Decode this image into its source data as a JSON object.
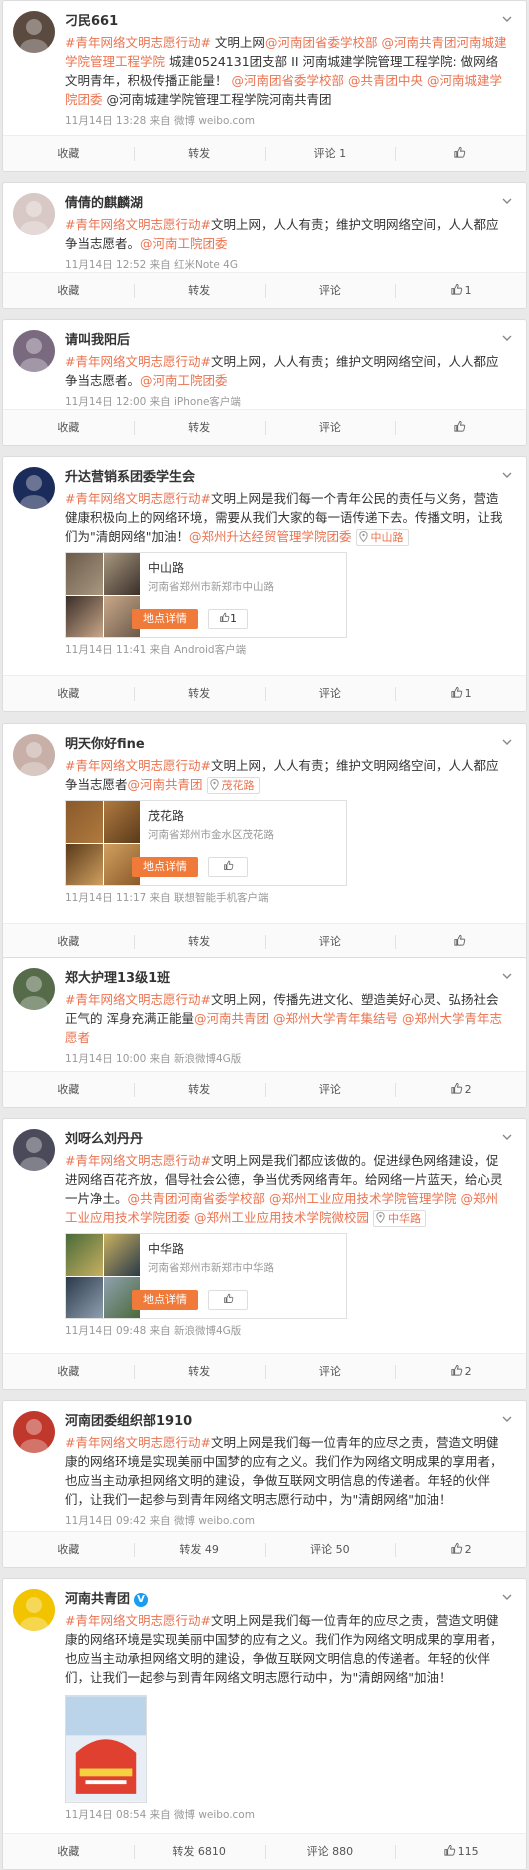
{
  "actions": {
    "collect": "收藏",
    "repost": "转发",
    "comment": "评论"
  },
  "location_button": "地点详情",
  "posts": [
    {
      "user": "刁民661",
      "text": [
        {
          "t": "#青年网络文明志愿行动#",
          "h": true
        },
        {
          "t": " 文明上网",
          "h": false
        },
        {
          "t": "@河南团省委学校部",
          "h": true
        },
        {
          "t": " ",
          "h": false
        },
        {
          "t": "@河南共青团河南城建学院管理工程学院",
          "h": true
        },
        {
          "t": " 城建0524131团支部 II 河南城建学院管理工程学院: 做网络文明青年，积极传播正能量！ ",
          "h": false
        },
        {
          "t": "@河南团省委学校部",
          "h": true
        },
        {
          "t": " ",
          "h": false
        },
        {
          "t": "@共青团中央",
          "h": true
        },
        {
          "t": " ",
          "h": false
        },
        {
          "t": "@河南城建学院团委",
          "h": true
        },
        {
          "t": " @河南城建学院管理工程学院河南共青团",
          "h": false
        }
      ],
      "meta": "11月14日 13:28 来自 微博 weibo.com",
      "repost": "",
      "comment": "1",
      "like": ""
    },
    {
      "user": "倩倩的麒麟湖",
      "text": [
        {
          "t": "#青年网络文明志愿行动#",
          "h": true
        },
        {
          "t": "文明上网，人人有责；维护文明网络空间，人人都应争当志愿者。",
          "h": false
        },
        {
          "t": "@河南工院团委",
          "h": true
        }
      ],
      "meta": "11月14日 12:52 来自 红米Note 4G",
      "repost": "",
      "comment": "",
      "like": "1"
    },
    {
      "user": "请叫我阳后",
      "text": [
        {
          "t": "#青年网络文明志愿行动#",
          "h": true
        },
        {
          "t": "文明上网，人人有责；维护文明网络空间，人人都应争当志愿者。",
          "h": false
        },
        {
          "t": "@河南工院团委",
          "h": true
        }
      ],
      "meta": "11月14日 12:00 来自 iPhone客户端",
      "repost": "",
      "comment": "",
      "like": ""
    },
    {
      "user": "升达营销系团委学生会",
      "text": [
        {
          "t": "#青年网络文明志愿行动#",
          "h": true
        },
        {
          "t": "文明上网是我们每一个青年公民的责任与义务，营造健康积极向上的网络环境，需要从我们大家的每一语传递下去。传播文明，让我们为\"清朗网络\"加油！",
          "h": false
        },
        {
          "t": "@郑州升达经贸管理学院团委",
          "h": true
        }
      ],
      "tag": "中山路",
      "location": {
        "name": "中山路",
        "addr": "河南省郑州市新郑市中山路",
        "likes": "1"
      },
      "meta": "11月14日 11:41 来自 Android客户端",
      "repost": "",
      "comment": "",
      "like": "1"
    },
    {
      "user": "明天你好fine",
      "text": [
        {
          "t": "#青年网络文明志愿行动#",
          "h": true
        },
        {
          "t": "文明上网，人人有责；维护文明网络空间，人人都应争当志愿者",
          "h": false
        },
        {
          "t": "@河南共青团",
          "h": true
        }
      ],
      "tag": "茂花路",
      "location": {
        "name": "茂花路",
        "addr": "河南省郑州市金水区茂花路",
        "likes": ""
      },
      "meta": "11月14日 11:17 来自 联想智能手机客户端",
      "repost": "",
      "comment": "",
      "like": ""
    },
    {
      "user": "郑大护理13级1班",
      "text": [
        {
          "t": "#青年网络文明志愿行动#",
          "h": true
        },
        {
          "t": "文明上网，传播先进文化、塑造美好心灵、弘扬社会正气的 浑身充满正能量",
          "h": false
        },
        {
          "t": "@河南共青团",
          "h": true
        },
        {
          "t": " ",
          "h": false
        },
        {
          "t": "@郑州大学青年集结号",
          "h": true
        },
        {
          "t": " ",
          "h": false
        },
        {
          "t": "@郑州大学青年志愿者",
          "h": true
        }
      ],
      "meta": "11月14日 10:00 来自 新浪微博4G版",
      "repost": "",
      "comment": "",
      "like": "2"
    },
    {
      "user": "刘呀么刘丹丹",
      "text": [
        {
          "t": "#青年网络文明志愿行动#",
          "h": true
        },
        {
          "t": "文明上网是我们都应该做的。促进绿色网络建设，促进网络百花齐放，倡导社会公德，争当优秀网络青年。给网络一片蓝天，给心灵一片净土。",
          "h": false
        },
        {
          "t": "@共青团河南省委学校部",
          "h": true
        },
        {
          "t": " ",
          "h": false
        },
        {
          "t": "@郑州工业应用技术学院管理学院",
          "h": true
        },
        {
          "t": " ",
          "h": false
        },
        {
          "t": "@郑州工业应用技术学院团委",
          "h": true
        },
        {
          "t": " ",
          "h": false
        },
        {
          "t": "@郑州工业应用技术学院微校园",
          "h": true
        }
      ],
      "tag": "中华路",
      "location": {
        "name": "中华路",
        "addr": "河南省郑州市新郑市中华路",
        "likes": ""
      },
      "meta": "11月14日 09:48 来自 新浪微博4G版",
      "repost": "",
      "comment": "",
      "like": "2"
    },
    {
      "user": "河南团委组织部1910",
      "text": [
        {
          "t": "#青年网络文明志愿行动#",
          "h": true
        },
        {
          "t": "文明上网是我们每一位青年的应尽之责，营造文明健康的网络环境是实现美丽中国梦的应有之义。我们作为网络文明成果的享用者，也应当主动承担网络文明的建设，争做互联网文明信息的传递者。年轻的伙伴们，让我们一起参与到青年网络文明志愿行动中，为\"清朗网络\"加油！",
          "h": false
        }
      ],
      "meta": "11月14日 09:42 来自 微博 weibo.com",
      "repost": "49",
      "comment": "50",
      "like": "2"
    },
    {
      "user": "河南共青团",
      "verified": true,
      "text": [
        {
          "t": "#青年网络文明志愿行动#",
          "h": true
        },
        {
          "t": "文明上网是我们每一位青年的应尽之责，营造文明健康的网络环境是实现美丽中国梦的应有之义。我们作为网络文明成果的享用者，也应当主动承担网络文明的建设，争做互联网文明信息的传递者。年轻的伙伴们，让我们一起参与到青年网络文明志愿行动中，为\"清朗网络\"加油！",
          "h": false
        }
      ],
      "image": true,
      "meta": "11月14日 08:54 来自 微博 weibo.com",
      "repost": "6810",
      "comment": "880",
      "like": "115"
    }
  ]
}
